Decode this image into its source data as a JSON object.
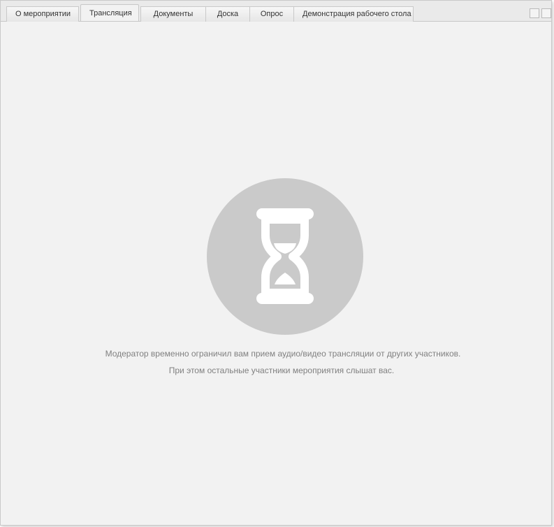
{
  "tabs": [
    {
      "label": "О мероприятии",
      "active": false
    },
    {
      "label": "Трансляция",
      "active": true
    },
    {
      "label": "Документы",
      "active": false
    },
    {
      "label": "Доска",
      "active": false
    },
    {
      "label": "Опрос",
      "active": false
    },
    {
      "label": "Демонстрация рабочего стола",
      "active": false
    }
  ],
  "status": {
    "icon": "hourglass-icon",
    "message_line1": "Модератор временно ограничил вам прием аудио/видео трансляции от других участников.",
    "message_line2": "При этом остальные участники мероприятия слышат вас."
  },
  "colors": {
    "background": "#f2f2f2",
    "icon_circle": "#cacaca",
    "icon_glyph": "#ffffff",
    "message_text": "#808080"
  }
}
